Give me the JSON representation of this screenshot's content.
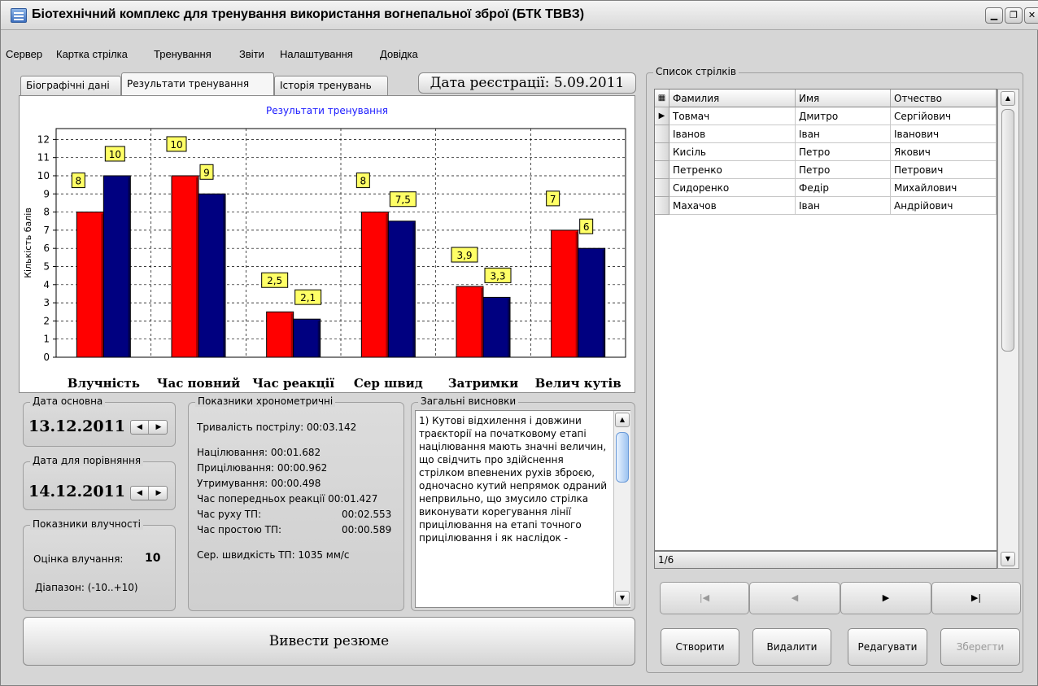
{
  "window": {
    "title": "Біотехнічний комплекс для тренування використання вогнепальної зброї (БТК ТВВЗ)"
  },
  "menu": [
    "Сервер",
    "Картка стрілка",
    "Тренування",
    "Звіти",
    "Налаштування",
    "Довідка"
  ],
  "tabs": [
    "Біографічні дані",
    "Результати тренування",
    "Історія тренувань"
  ],
  "active_tab": 1,
  "registration": "Дата реєстрації: 5.09.2011",
  "chart_data": {
    "type": "bar",
    "title": "Результати тренування",
    "ylabel": "Кількість балів",
    "xlabel": "",
    "categories": [
      "Влучність",
      "Час повний",
      "Час реакції",
      "Сер швид",
      "Затримки",
      "Велич кутів"
    ],
    "series": [
      {
        "color": "#ff0000",
        "values": [
          8,
          10,
          2.5,
          8,
          3.9,
          7
        ],
        "labels": [
          "8",
          "10",
          "2,5",
          "8",
          "3,9",
          "7"
        ]
      },
      {
        "color": "#000080",
        "values": [
          10,
          9,
          2.1,
          7.5,
          3.3,
          6
        ],
        "labels": [
          "10",
          "9",
          "2,1",
          "7,5",
          "3,3",
          "6"
        ]
      }
    ],
    "ylim": [
      0,
      12.6
    ],
    "yticks": [
      "0",
      "1",
      "2",
      "3",
      "4",
      "5",
      "6",
      "7",
      "8",
      "9",
      "10",
      "11",
      "12"
    ],
    "grid": true,
    "label_color": "#ffff66"
  },
  "date_main": {
    "legend": "Дата основна",
    "value": "13.12.2011"
  },
  "date_compare": {
    "legend": "Дата для порівняння",
    "value": "14.12.2011"
  },
  "accuracy": {
    "legend": "Показники влучності",
    "score_label": "Оцінка влучання:",
    "score_value": "10",
    "range": "Діапазон: (-10..+10)"
  },
  "chrono": {
    "legend": "Показники хронометричні",
    "shot_duration": "Тривалість пострілу:  00:03.142",
    "aiming": "Націлювання:  00:01.682",
    "targeting": "Прицілювання: 00:00.962",
    "holding": "Утримування:  00:00.498",
    "prev_reaction": "Час попередньох реакції 00:01.427",
    "tp_move_label": "Час руху ТП:",
    "tp_move_value": "00:02.553",
    "tp_idle_label": "Час простою ТП:",
    "tp_idle_value": "00:00.589",
    "avg_speed": "Сер. швидкість ТП:  1035 мм/с"
  },
  "conclusions": {
    "legend": "Загальні висновки",
    "text": "1) Кутові відхилення і довжини траєкторії на початковому етапі націлювання мають значні величин, що свідчить про здійснення стрілком впевнених рухів зброєю, одночасно кутий непрямок одраний непрвильно, що змусило стрілка\nвиконувати корегування лінії прицілювання на етапі точного прицілювання і як наслідок -"
  },
  "summary_button": "Вивести резюме",
  "shooters": {
    "legend": "Список стрілків",
    "columns": [
      "Фамилия",
      "Имя",
      "Отчество"
    ],
    "rows": [
      [
        "Товмач",
        "Дмитро",
        "Сергійович"
      ],
      [
        "Іванов",
        "Іван",
        "Іванович"
      ],
      [
        "Кисіль",
        "Петро",
        "Якович"
      ],
      [
        "Петренко",
        "Петро",
        "Петрович"
      ],
      [
        "Сидоренко",
        "Федір",
        "Михайлович"
      ],
      [
        "Махачов",
        "Іван",
        "Андрійович"
      ]
    ],
    "selected_row": 0,
    "status": "1/6"
  },
  "nav": {
    "first": "|◀",
    "prev": "◀",
    "next": "▶",
    "last": "▶|"
  },
  "actions": {
    "create": "Створити",
    "delete": "Видалити",
    "edit": "Редагувати",
    "save": "Зберегти"
  }
}
